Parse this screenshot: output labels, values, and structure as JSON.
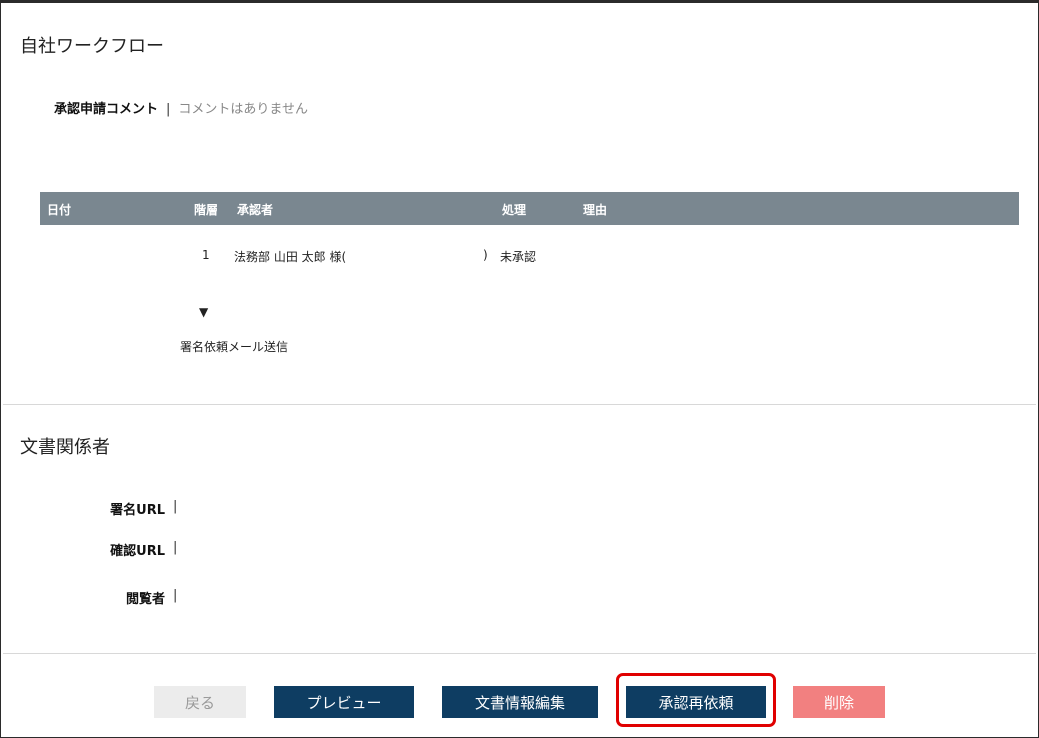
{
  "workflow": {
    "title": "自社ワークフロー",
    "comment_label": "承認申請コメント",
    "separator": "|",
    "comment_value": "コメントはありません",
    "table": {
      "headers": {
        "date": "日付",
        "level": "階層",
        "approver": "承認者",
        "action": "処理",
        "reason": "理由"
      },
      "rows": [
        {
          "date": "",
          "level": "1",
          "approver_name": "法務部 山田 太郎 様(",
          "approver_close": ")",
          "action": "未承認",
          "reason": ""
        }
      ]
    },
    "arrow": "▼",
    "mail_step": "署名依頼メール送信"
  },
  "related": {
    "title": "文書関係者",
    "sign_url_label": "署名URL",
    "confirm_url_label": "確認URL",
    "viewer_label": "閲覧者",
    "separator": "|"
  },
  "footer": {
    "back_label": "戻る",
    "preview_label": "プレビュー",
    "edit_info_label": "文書情報編集",
    "rerequest_label": "承認再依頼",
    "delete_label": "削除"
  },
  "colors": {
    "table_header": "#7a8790",
    "primary_button": "#0e3d62",
    "delete_button": "#f28080",
    "disabled_button": "#ececec",
    "highlight": "#e00000"
  }
}
